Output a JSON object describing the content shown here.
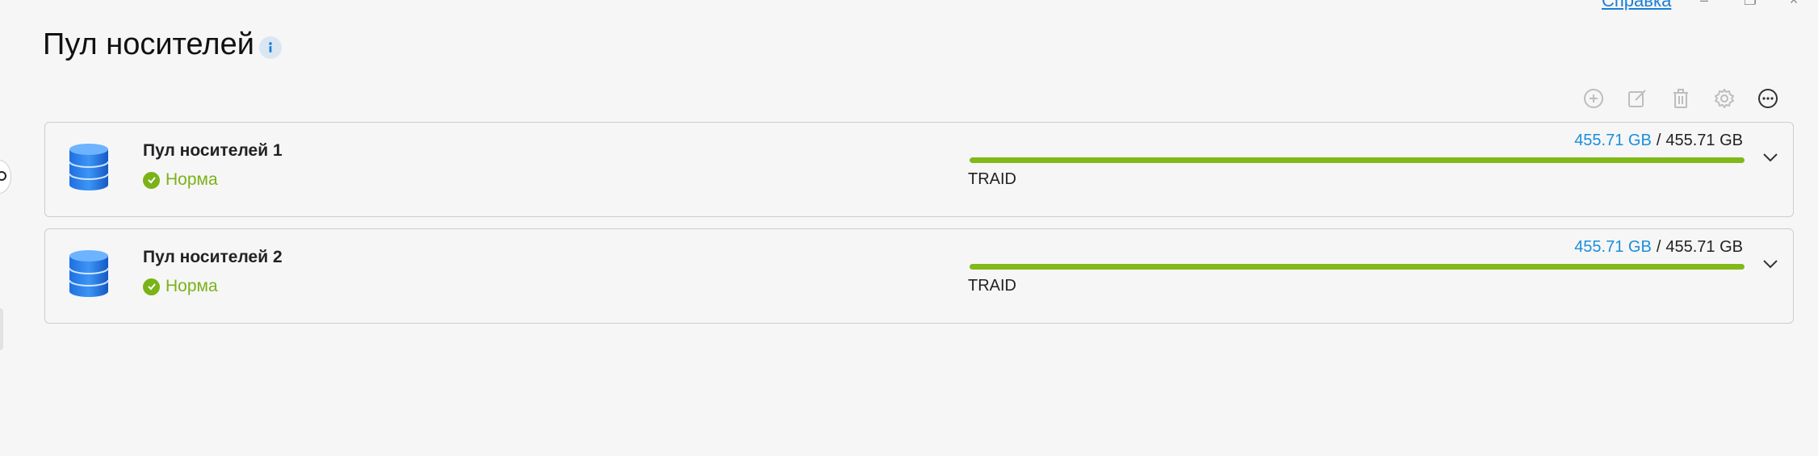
{
  "window": {
    "help_label": "Справка",
    "minimize_glyph": "–",
    "maximize_glyph": "❐",
    "close_glyph": "×"
  },
  "header": {
    "title": "Пул носителей",
    "info_icon": "info-icon"
  },
  "toolbar": {
    "items": [
      {
        "icon": "add-circle-icon",
        "enabled": false
      },
      {
        "icon": "edit-icon",
        "enabled": false
      },
      {
        "icon": "trash-icon",
        "enabled": false
      },
      {
        "icon": "gear-icon",
        "enabled": false
      },
      {
        "icon": "more-icon",
        "enabled": true
      }
    ]
  },
  "pools": [
    {
      "name": "Пул носителей 1",
      "status": "Норма",
      "used": "455.71 GB",
      "separator": "/",
      "total": "455.71 GB",
      "usage_fraction": 1.0,
      "raid_type": "TRAID"
    },
    {
      "name": "Пул носителей 2",
      "status": "Норма",
      "used": "455.71 GB",
      "separator": "/",
      "total": "455.71 GB",
      "usage_fraction": 1.0,
      "raid_type": "TRAID"
    }
  ],
  "colors": {
    "accent_blue": "#1a8fdc",
    "status_green": "#7ab317",
    "bar_green": "#80b918"
  }
}
